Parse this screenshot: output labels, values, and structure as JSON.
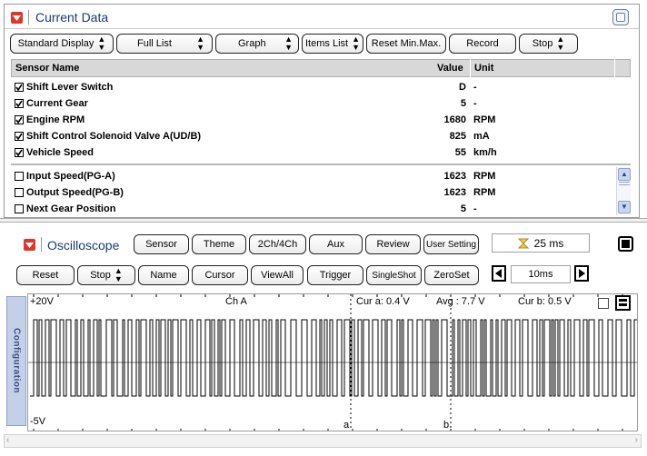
{
  "current_data": {
    "title": "Current Data",
    "toolbar": [
      {
        "label": "Standard Display",
        "spinner": true
      },
      {
        "label": "Full List",
        "spinner": true
      },
      {
        "label": "Graph",
        "spinner": true
      },
      {
        "label": "Items List",
        "spinner": true
      },
      {
        "label": "Reset Min.Max.",
        "spinner": false
      },
      {
        "label": "Record",
        "spinner": false
      },
      {
        "label": "Stop",
        "spinner": true
      }
    ],
    "columns": {
      "name": "Sensor Name",
      "value": "Value",
      "unit": "Unit"
    },
    "pinned_rows": [
      {
        "name": "Shift Lever Switch",
        "value": "D",
        "unit": "-",
        "checked": true
      },
      {
        "name": "Current Gear",
        "value": "5",
        "unit": "-",
        "checked": true
      },
      {
        "name": "Engine RPM",
        "value": "1680",
        "unit": "RPM",
        "checked": true
      },
      {
        "name": "Shift Control Solenoid Valve A(UD/B)",
        "value": "825",
        "unit": "mA",
        "checked": true
      },
      {
        "name": "Vehicle Speed",
        "value": "55",
        "unit": "km/h",
        "checked": true
      }
    ],
    "list_rows": [
      {
        "name": "Input Speed(PG-A)",
        "value": "1623",
        "unit": "RPM",
        "checked": false
      },
      {
        "name": "Output Speed(PG-B)",
        "value": "1623",
        "unit": "RPM",
        "checked": false
      },
      {
        "name": "Next Gear Position",
        "value": "5",
        "unit": "-",
        "checked": false
      }
    ]
  },
  "oscilloscope": {
    "title": "Oscilloscope",
    "top_buttons": [
      "Sensor",
      "Theme",
      "2Ch/4Ch",
      "Aux",
      "Review",
      "User Setting"
    ],
    "sample_time": "25 ms",
    "bottom_buttons": [
      {
        "label": "Reset",
        "spinner": false
      },
      {
        "label": "Stop",
        "spinner": true
      },
      {
        "label": "Name",
        "spinner": false
      },
      {
        "label": "Cursor",
        "spinner": false
      },
      {
        "label": "ViewAll",
        "spinner": false
      },
      {
        "label": "Trigger",
        "spinner": false
      },
      {
        "label": "SingleShot",
        "spinner": false
      },
      {
        "label": "ZeroSet",
        "spinner": false
      }
    ],
    "timebase": "10ms",
    "side_tab": "Configuration",
    "y_max_label": "+20V",
    "y_min_label": "-5V",
    "channel_label": "Ch A",
    "cur_a": "Cur a: 0.4 V",
    "avg": "Avg : 7.7 V",
    "cur_b": "Cur b: 0.5 V",
    "cursor_a": "a",
    "cursor_b": "b"
  },
  "colors": {
    "accent_red": "#e0352b",
    "title_blue": "#1a3a78",
    "header_bg": "#d8d8d8"
  }
}
